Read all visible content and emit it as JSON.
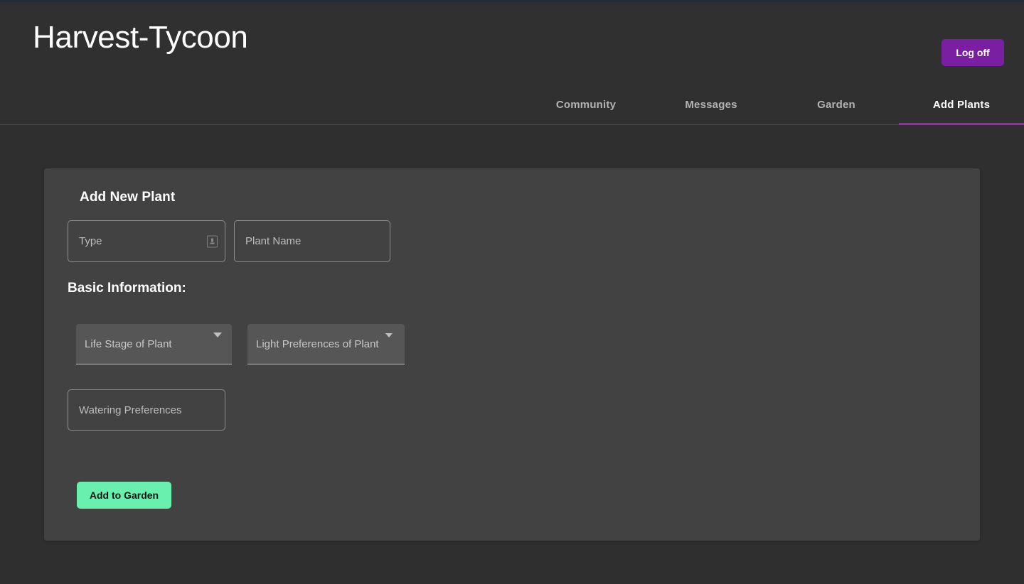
{
  "app": {
    "title": "Harvest-Tycoon",
    "accent_purple": "#7b1fa2",
    "accent_green": "#69f0ae",
    "page_background": "#2f2f2f",
    "card_background": "#424242"
  },
  "header": {
    "logoff_label": "Log off"
  },
  "nav": {
    "tabs": [
      {
        "label": "Community",
        "active": false
      },
      {
        "label": "Messages",
        "active": false
      },
      {
        "label": "Garden",
        "active": false
      },
      {
        "label": "Add Plants",
        "active": true
      }
    ]
  },
  "form": {
    "card_title": "Add New Plant",
    "section_title": "Basic Information:",
    "type_field": {
      "placeholder": "Type",
      "value": "",
      "icon": "stepper-icon"
    },
    "plant_name_field": {
      "placeholder": "Plant Name",
      "value": ""
    },
    "life_stage_select": {
      "label": "Life Stage of Plant",
      "value": ""
    },
    "light_preferences_select": {
      "label": "Light Preferences of Plant",
      "value": ""
    },
    "watering_field": {
      "placeholder": "Watering Preferences",
      "value": ""
    },
    "submit_label": "Add to Garden"
  }
}
